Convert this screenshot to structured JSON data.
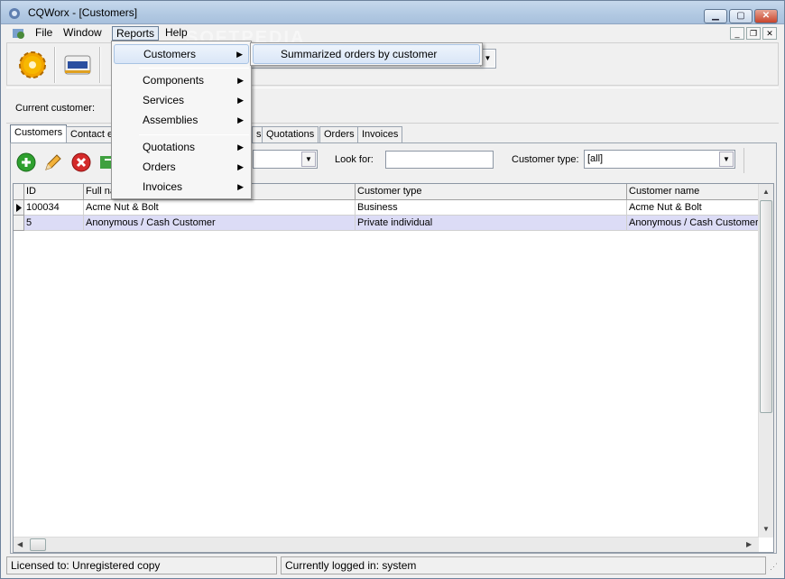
{
  "window": {
    "title": "CQWorx - [Customers]"
  },
  "menubar": {
    "file": "File",
    "window": "Window",
    "reports": "Reports",
    "help": "Help"
  },
  "customer_bar": {
    "label": "Current customer:"
  },
  "tabs": [
    "Customers",
    "Contact e",
    "s",
    "Quotations",
    "Orders",
    "Invoices"
  ],
  "filters": {
    "look_for_label": "Look for:",
    "look_for_value": "",
    "customer_type_label": "Customer type:",
    "customer_type_value": "[all]"
  },
  "grid": {
    "columns": [
      "ID",
      "Full na",
      "Customer type",
      "Customer name"
    ],
    "rows": [
      [
        "100034",
        "Acme Nut & Bolt",
        "Business",
        "Acme Nut & Bolt"
      ],
      [
        "5",
        "Anonymous / Cash Customer",
        "Private individual",
        "Anonymous / Cash Customer"
      ]
    ]
  },
  "reports_menu": {
    "items": [
      "Customers",
      "Components",
      "Services",
      "Assemblies",
      "Quotations",
      "Orders",
      "Invoices"
    ],
    "customers_submenu": [
      "Summarized orders by customer"
    ]
  },
  "status": {
    "license": "Licensed to: Unregistered copy",
    "user": "Currently logged in: system"
  },
  "watermark": "SOFTPEDIA",
  "icons": [
    "app-icon",
    "settings-gear-icon",
    "credit-card-icon",
    "add-icon",
    "edit-pencil-icon",
    "delete-icon",
    "refresh-icon"
  ],
  "colors": {
    "selected_row": "#dcdcf6",
    "titlebar": "#b4cbe4"
  }
}
